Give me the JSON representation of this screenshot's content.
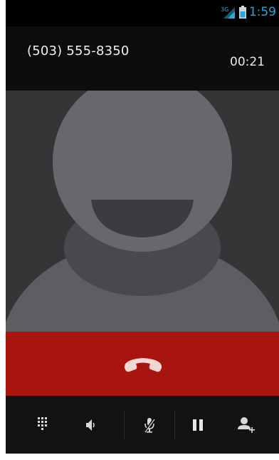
{
  "status_bar": {
    "network": "3G",
    "time": "1:59",
    "signal_icon": "signal-strength-icon",
    "battery_icon": "battery-icon",
    "time_color": "#2aa6dd"
  },
  "call": {
    "phone_number": "(503) 555-8350",
    "duration": "00:21"
  },
  "photo": {
    "icon": "default-contact-avatar-icon"
  },
  "end_call": {
    "icon": "end-call-handset-icon",
    "color": "#a8140e"
  },
  "controls": [
    {
      "name": "dialpad",
      "icon": "dialpad-icon"
    },
    {
      "name": "speaker",
      "icon": "speaker-icon"
    },
    {
      "name": "mute",
      "icon": "mute-microphone-icon"
    },
    {
      "name": "hold",
      "icon": "pause-icon"
    },
    {
      "name": "add-call",
      "icon": "add-person-icon"
    }
  ]
}
